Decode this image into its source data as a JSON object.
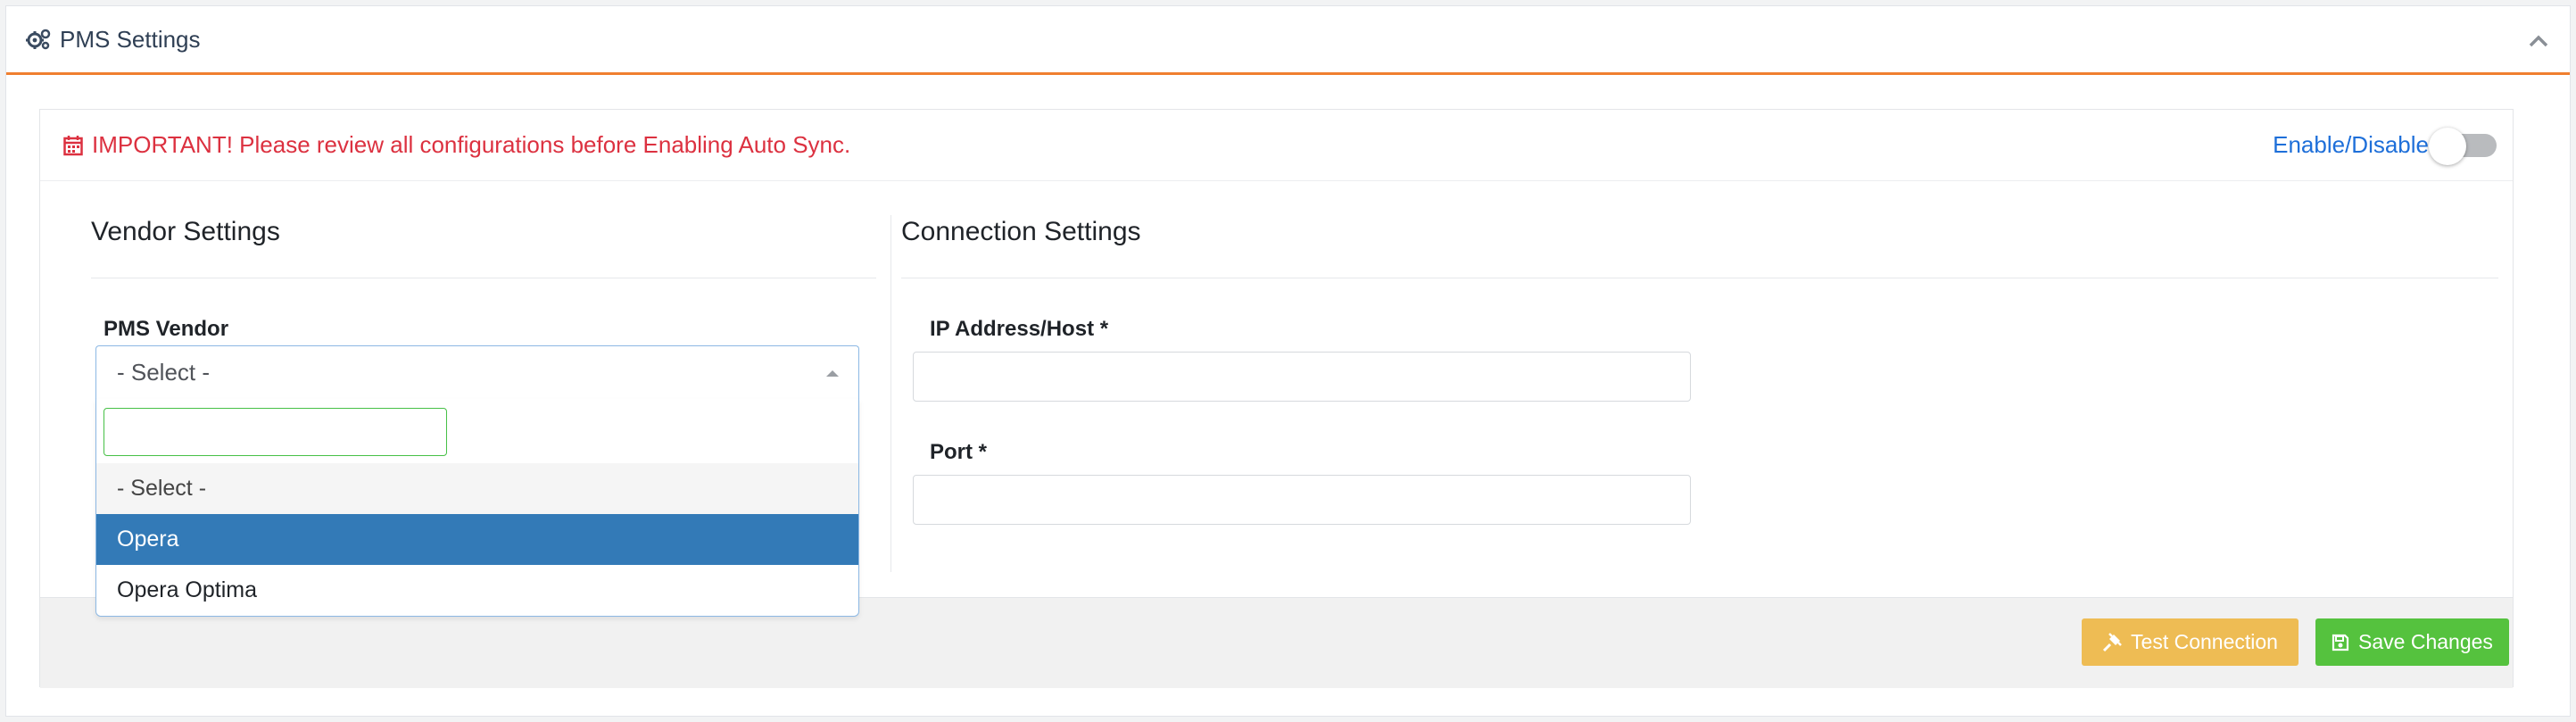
{
  "header": {
    "title": "PMS Settings",
    "icon": "gears-icon",
    "collapse_icon": "chevron-up-icon"
  },
  "notice": {
    "icon": "calendar-icon",
    "text": "IMPORTANT! Please review all configurations before Enabling Auto Sync.",
    "color": "#dc3140"
  },
  "toggle": {
    "label": "Enable/Disable",
    "enabled": false
  },
  "vendor_settings": {
    "title": "Vendor Settings",
    "pms_vendor": {
      "label": "PMS Vendor",
      "selected": "- Select -",
      "search_value": "",
      "options": [
        "- Select -",
        "Opera",
        "Opera Optima"
      ],
      "highlighted": "Opera"
    }
  },
  "connection_settings": {
    "title": "Connection Settings",
    "host": {
      "label": "IP Address/Host *",
      "value": ""
    },
    "port": {
      "label": "Port *",
      "value": ""
    }
  },
  "footer": {
    "test_label": "Test Connection",
    "save_label": "Save Changes",
    "test_icon": "plug-icon",
    "save_icon": "floppy-disk-icon"
  },
  "colors": {
    "accent": "#f07f2f",
    "link": "#1e6fd9",
    "highlight": "#337ab7",
    "warning_button": "#eebc54",
    "success_button": "#55c23e"
  }
}
